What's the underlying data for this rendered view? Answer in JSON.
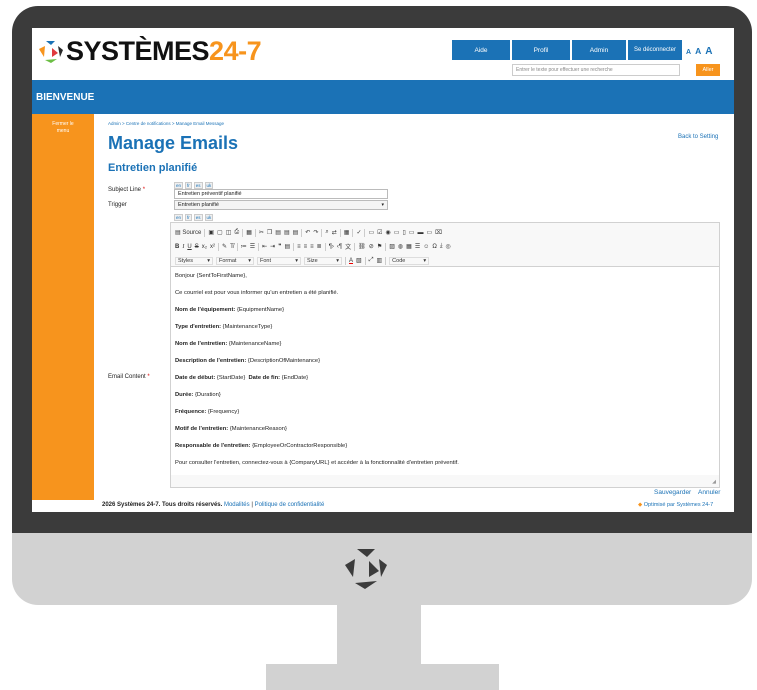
{
  "logo": {
    "part1": "SYSTÈMES",
    "part2": "24-7"
  },
  "nav": {
    "aide": "Aide",
    "profil": "Profil",
    "admin": "Admin",
    "logout": "Se déconnecter",
    "font_sizes": [
      "A",
      "A",
      "A"
    ]
  },
  "search": {
    "placeholder": "Entrer le texte pour effectuer une recherche",
    "button": "Aller"
  },
  "banner": {
    "title": "BIENVENUE"
  },
  "sidebar": {
    "close_menu": "Fermer le menu"
  },
  "breadcrumb": "Admin > Centre de notifications > Manage Email Message",
  "page": {
    "title": "Manage Emails",
    "subtitle": "Entretien planifié",
    "back": "Back to Setting"
  },
  "form": {
    "subject_label": "Subject Line",
    "subject_value": "Entretien préventif planifié",
    "trigger_label": "Trigger",
    "trigger_value": "Entretien planifié",
    "content_label": "Email Content",
    "required_mark": "*",
    "langs": [
      "en",
      "fr",
      "es",
      "uk"
    ]
  },
  "toolbar": {
    "source": "Source",
    "styles": "Styles",
    "format": "Format",
    "font": "Font",
    "size": "Size",
    "code": "Code"
  },
  "email": {
    "greeting": "Bonjour {SentToFirstName},",
    "intro": "Ce courriel est pour vous informer qu'un entretien a été planifié.",
    "l1_label": "Nom de l'équipement:",
    "l1_value": "{EquipmentName}",
    "l2_label": "Type d'entretien:",
    "l2_value": "{MaintenanceType}",
    "l3_label": "Nom de l'entretien:",
    "l3_value": "{MaintenanceName}",
    "l4_label": "Description de l'entretien:",
    "l4_value": "{DescriptionOfMaintenance}",
    "l5a_label": "Date de début:",
    "l5a_value": "{StartDate}",
    "l5b_label": "Date de fin:",
    "l5b_value": "{EndDate}",
    "l6_label": "Durée:",
    "l6_value": "{Duration}",
    "l7_label": "Fréquence:",
    "l7_value": "{Frequency}",
    "l8_label": "Motif de l'entretien:",
    "l8_value": "{MaintenanceReason}",
    "l9_label": "Responsable de l'entretien:",
    "l9_value": "{EmployeeOrContractorResponsible}",
    "outro": "Pour consulter l'entretien, connectez-vous à {CompanyURL} et accéder à la fonctionnalité d'entretien préventif."
  },
  "actions": {
    "save": "Sauvegarder",
    "cancel": "Annuler"
  },
  "footer": {
    "copyright": "2026 Systèmes 24-7. Tous droits réservés.",
    "modalites": "Modalités",
    "sep": "|",
    "privacy": "Politique de confidentialité",
    "powered": "Optimisé par Systèmes 24-7"
  },
  "colors": {
    "brand_blue": "#1b72b6",
    "accent_orange": "#f7941d",
    "bezel": "#3b3b3b",
    "stand": "#d2d2d2"
  }
}
